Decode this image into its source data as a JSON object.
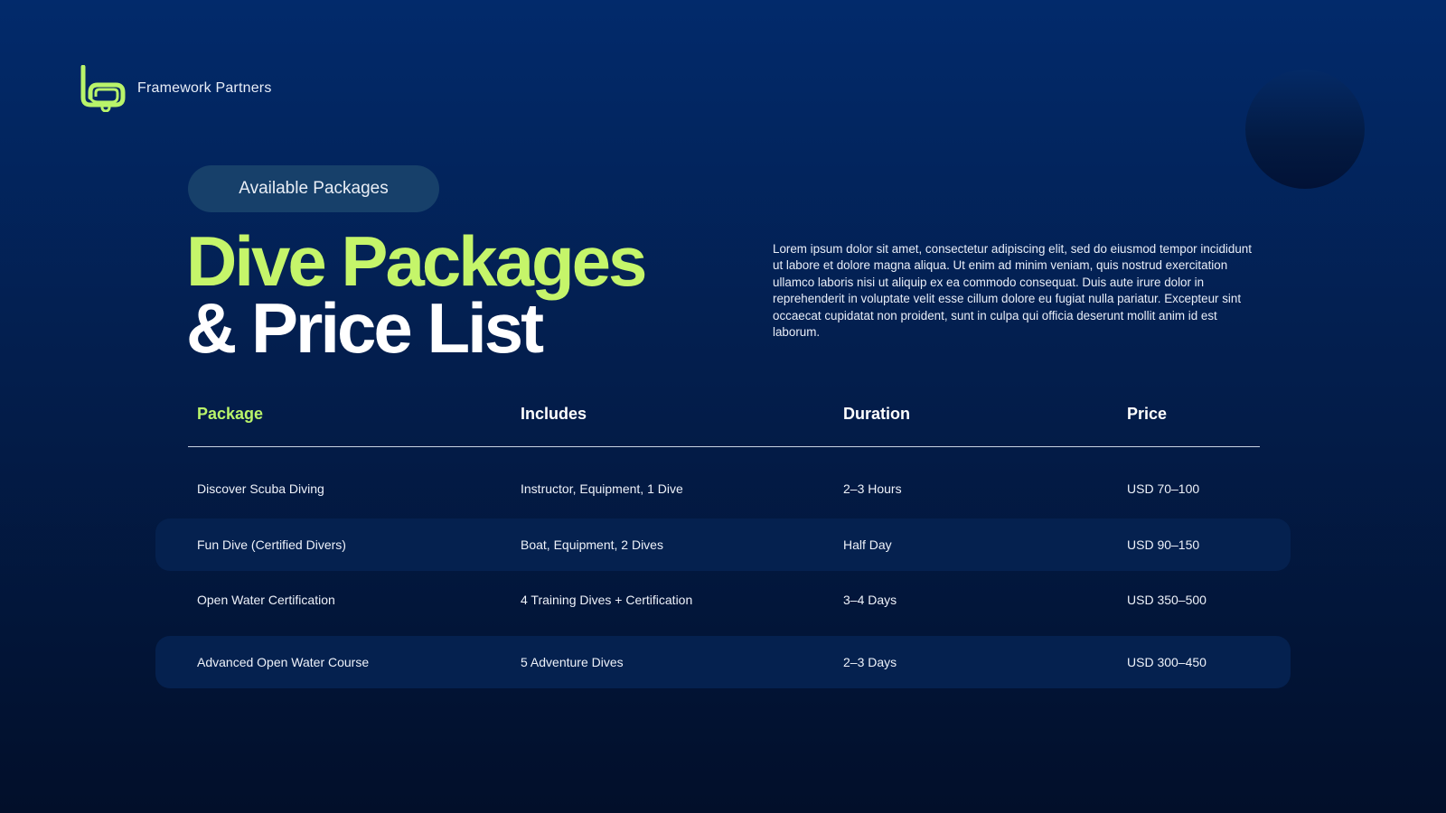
{
  "brand": {
    "name": "Framework Partners",
    "logo_icon": "snorkel-mask-icon",
    "accent_color": "#b9f46a"
  },
  "badge": {
    "label": "Available Packages"
  },
  "title": {
    "line1": "Dive Packages",
    "line2": "& Price List"
  },
  "description": "Lorem ipsum dolor sit amet, consectetur adipiscing elit, sed do eiusmod tempor incididunt ut labore et dolore magna aliqua. Ut enim ad minim veniam, quis nostrud exercitation ullamco laboris nisi ut aliquip ex ea commodo consequat. Duis aute irure dolor in reprehenderit in voluptate velit esse cillum dolore eu fugiat nulla pariatur. Excepteur sint occaecat cupidatat non proident, sunt in culpa qui officia deserunt mollit anim id est laborum.",
  "table": {
    "headers": [
      "Package",
      "Includes",
      "Duration",
      "Price"
    ],
    "rows": [
      [
        "Discover Scuba Diving",
        "Instructor, Equipment, 1 Dive",
        "2–3 Hours",
        "USD 70–100"
      ],
      [
        "Fun Dive (Certified Divers)",
        "Boat, Equipment, 2 Dives",
        "Half Day",
        "USD 90–150"
      ],
      [
        "Open Water Certification",
        "4 Training Dives + Certification",
        "3–4 Days",
        "USD 350–500"
      ],
      [
        "Advanced Open Water Course",
        "5 Adventure Dives",
        "2–3 Days",
        "USD 300–450"
      ]
    ]
  },
  "colors": {
    "background_top": "#022a6b",
    "background_bottom": "#020f2a",
    "alt_row": "#05214f",
    "badge_bg": "#17406a"
  }
}
